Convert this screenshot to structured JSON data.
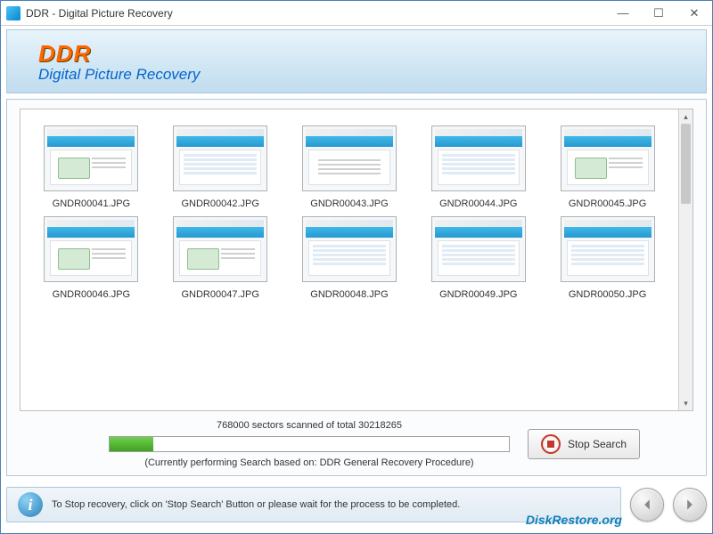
{
  "window": {
    "title": "DDR - Digital Picture Recovery"
  },
  "header": {
    "logo": "DDR",
    "app_title": "Digital Picture Recovery"
  },
  "thumbnails": [
    {
      "label": "GNDR00041.JPG"
    },
    {
      "label": "GNDR00042.JPG"
    },
    {
      "label": "GNDR00043.JPG"
    },
    {
      "label": "GNDR00044.JPG"
    },
    {
      "label": "GNDR00045.JPG"
    },
    {
      "label": "GNDR00046.JPG"
    },
    {
      "label": "GNDR00047.JPG"
    },
    {
      "label": "GNDR00048.JPG"
    },
    {
      "label": "GNDR00049.JPG"
    },
    {
      "label": "GNDR00050.JPG"
    }
  ],
  "progress": {
    "status": "768000 sectors scanned of total 30218265",
    "note": "(Currently performing Search based on:  DDR General Recovery Procedure)",
    "stop_label": "Stop Search",
    "percent": 11
  },
  "footer": {
    "info_text": "To Stop recovery, click on 'Stop Search' Button or please wait for the process to be completed.",
    "website": "DiskRestore.org"
  }
}
